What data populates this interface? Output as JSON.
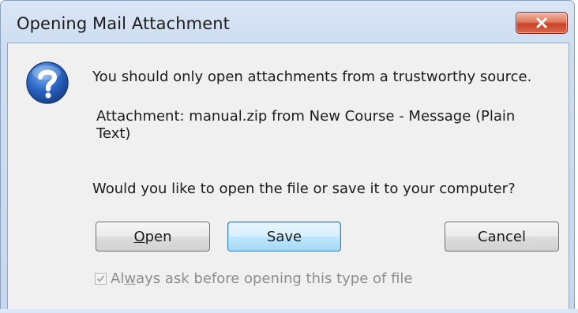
{
  "window": {
    "title": "Opening Mail Attachment",
    "close_label": "Close"
  },
  "dialog": {
    "icon": "question-icon",
    "warning": "You should only open attachments from a trustworthy source.",
    "attachment_line": "Attachment: manual.zip from New Course - Message (Plain Text)",
    "question": "Would you like to open the file or save it to your computer?"
  },
  "buttons": {
    "open": {
      "label_underlined": "O",
      "label_rest": "pen"
    },
    "save": {
      "label": "Save"
    },
    "cancel": {
      "label": "Cancel"
    }
  },
  "checkbox": {
    "checked": true,
    "enabled": false,
    "label_before": "Al",
    "label_underlined": "w",
    "label_after": "ays ask before opening this type of file"
  },
  "colors": {
    "title_bar": "#cfdef1",
    "client_bg": "#f0f0f0",
    "close_button": "#c9432a",
    "default_button_border": "#3c7fb1",
    "disabled_text": "#8d8d8d"
  }
}
